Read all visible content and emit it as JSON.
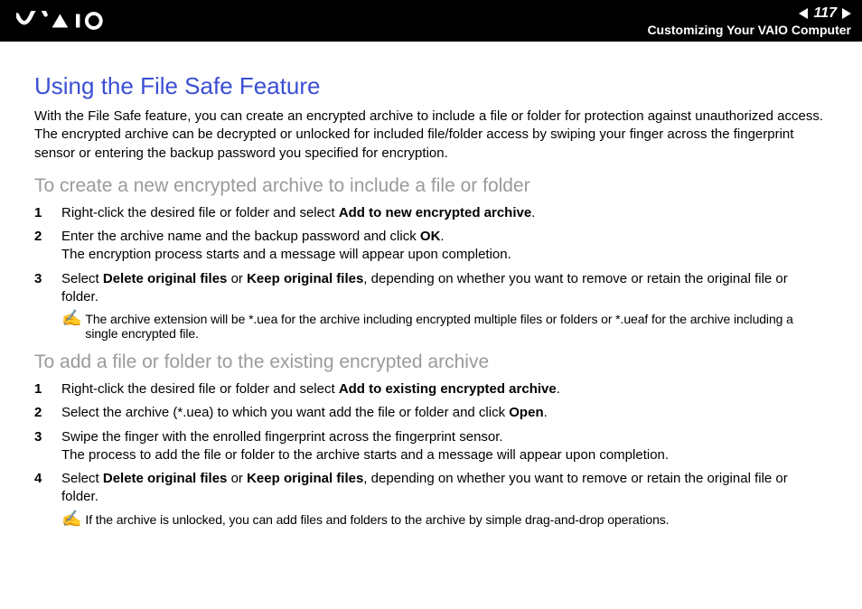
{
  "header": {
    "page_number": "117",
    "breadcrumb": "Customizing Your VAIO Computer"
  },
  "title": "Using the File Safe Feature",
  "lead": "With the File Safe feature, you can create an encrypted archive to include a file or folder for protection against unauthorized access. The encrypted archive can be decrypted or unlocked for included file/folder access by swiping your finger across the fingerprint sensor or entering the backup password you specified for encryption.",
  "section1": {
    "heading": "To create a new encrypted archive to include a file or folder",
    "steps": {
      "s1a": "Right-click the desired file or folder and select ",
      "s1b": "Add to new encrypted archive",
      "s1c": ".",
      "s2a": "Enter the archive name and the backup password and click ",
      "s2b": "OK",
      "s2c": ".",
      "s2d": "The encryption process starts and a message will appear upon completion.",
      "s3a": "Select ",
      "s3b": "Delete original files",
      "s3c": " or ",
      "s3d": "Keep original files",
      "s3e": ", depending on whether you want to remove or retain the original file or folder."
    },
    "note": "The archive extension will be *.uea for the archive including encrypted multiple files or folders or *.ueaf for the archive including a single encrypted file."
  },
  "section2": {
    "heading": "To add a file or folder to the existing encrypted archive",
    "steps": {
      "s1a": "Right-click the desired file or folder and select ",
      "s1b": "Add to existing encrypted archive",
      "s1c": ".",
      "s2a": "Select the archive (*.uea) to which you want add the file or folder and click ",
      "s2b": "Open",
      "s2c": ".",
      "s3a": "Swipe the finger with the enrolled fingerprint across the fingerprint sensor.",
      "s3b": "The process to add the file or folder to the archive starts and a message will appear upon completion.",
      "s4a": "Select ",
      "s4b": "Delete original files",
      "s4c": " or ",
      "s4d": "Keep original files",
      "s4e": ", depending on whether you want to remove or retain the original file or folder."
    },
    "note": "If the archive is unlocked, you can add files and folders to the archive by simple drag-and-drop operations."
  },
  "nums": {
    "n1": "1",
    "n2": "2",
    "n3": "3",
    "n4": "4"
  }
}
